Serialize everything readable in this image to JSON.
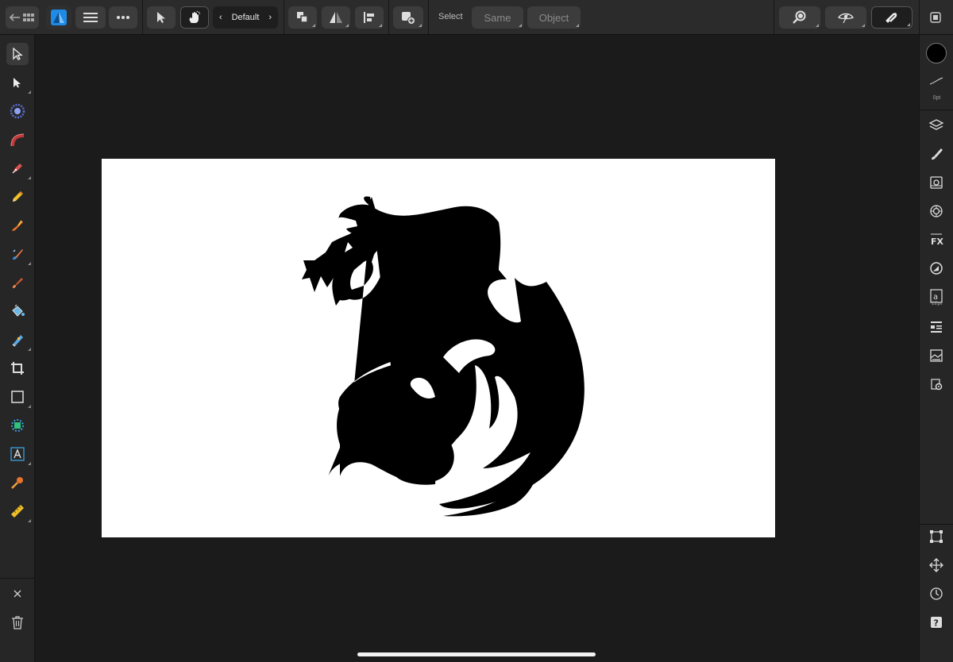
{
  "toolbar": {
    "persona_preset_label": "Default",
    "select_label": "Select",
    "same_button_label": "Same",
    "object_button_label": "Object"
  },
  "colors": {
    "accent": "#1e8be6",
    "fill_swatch": "#000000",
    "canvas_background": "#ffffff",
    "workspace_background": "#1b1b1b"
  },
  "right_panel": {
    "stroke_width_label": "0pt",
    "text_size_label": "12pt"
  },
  "icons": {
    "left_tools": [
      "move-tool-icon",
      "node-tool-icon",
      "corner-tool-icon",
      "shape-builder-icon",
      "pen-tool-icon",
      "pencil-tool-icon",
      "vector-brush-icon",
      "paint-brush-icon",
      "brush-icon",
      "fill-tool-icon",
      "transparency-tool-icon",
      "crop-tool-icon",
      "rectangle-tool-icon",
      "place-image-icon",
      "artistic-text-icon",
      "color-picker-icon",
      "measure-tool-icon"
    ],
    "right_studios": [
      "layers-icon",
      "brushes-icon",
      "assets-icon",
      "swatches-icon",
      "effects-icon",
      "color-icon",
      "text-styles-icon",
      "navigator-icon",
      "gallery-icon",
      "settings-icon",
      "transform-icon",
      "move-icon",
      "history-icon",
      "help-icon"
    ]
  }
}
